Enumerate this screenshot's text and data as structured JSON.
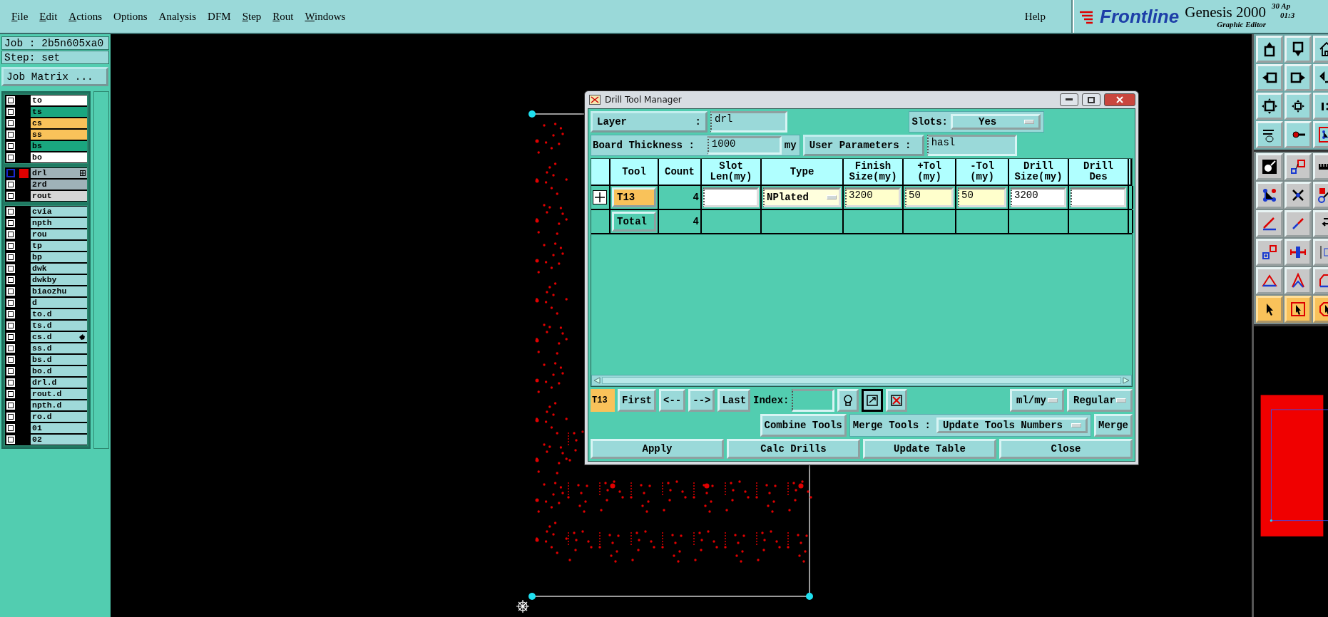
{
  "menu_bar": {
    "items": [
      {
        "label": "File",
        "mnemonic": true
      },
      {
        "label": "Edit",
        "mnemonic": true
      },
      {
        "label": "Actions",
        "mnemonic": true
      },
      {
        "label": "Options",
        "mnemonic": false
      },
      {
        "label": "Analysis",
        "mnemonic": false
      },
      {
        "label": "DFM",
        "mnemonic": false
      },
      {
        "label": "Step",
        "mnemonic": true
      },
      {
        "label": "Rout",
        "mnemonic": true
      },
      {
        "label": "Windows",
        "mnemonic": true
      }
    ],
    "help": "Help"
  },
  "brand": {
    "logo": "Frontline",
    "product": "Genesis 2000",
    "subtitle": "Graphic Editor",
    "date": "30 Ap",
    "time": "01:3"
  },
  "job_panel": {
    "job": "Job : 2b5n605xa0",
    "step": "Step: set",
    "matrix_button": "Job Matrix ...",
    "layer_groups": [
      {
        "layers": [
          {
            "name": "to",
            "color": "#ffffff",
            "affected": false,
            "work": false,
            "opened": false,
            "pointer": false
          },
          {
            "name": "ts",
            "color": "#1aa67f",
            "affected": false,
            "work": false,
            "opened": false,
            "pointer": false
          },
          {
            "name": "cs",
            "color": "#f9c25a",
            "affected": false,
            "work": false,
            "opened": false,
            "pointer": false
          },
          {
            "name": "ss",
            "color": "#f9c25a",
            "affected": false,
            "work": false,
            "opened": false,
            "pointer": false
          },
          {
            "name": "bs",
            "color": "#1aa67f",
            "affected": false,
            "work": false,
            "opened": false,
            "pointer": false
          },
          {
            "name": "bo",
            "color": "#ffffff",
            "affected": false,
            "work": false,
            "opened": false,
            "pointer": false
          }
        ]
      },
      {
        "layers": [
          {
            "name": "drl",
            "color": "#9fb2b8",
            "affected": true,
            "work": true,
            "opened": true,
            "pointer": false
          },
          {
            "name": "2rd",
            "color": "#9fb2b8",
            "affected": false,
            "work": false,
            "opened": false,
            "pointer": false
          },
          {
            "name": "rout",
            "color": "#d6d6d6",
            "affected": false,
            "work": false,
            "opened": false,
            "pointer": false
          }
        ]
      },
      {
        "layers": [
          {
            "name": "cvia",
            "color": "#9fd9d9",
            "affected": false,
            "work": false,
            "opened": false,
            "pointer": false
          },
          {
            "name": "npth",
            "color": "#9fd9d9",
            "affected": false,
            "work": false,
            "opened": false,
            "pointer": false
          },
          {
            "name": "rou",
            "color": "#9fd9d9",
            "affected": false,
            "work": false,
            "opened": false,
            "pointer": false
          },
          {
            "name": "tp",
            "color": "#9fd9d9",
            "affected": false,
            "work": false,
            "opened": false,
            "pointer": false
          },
          {
            "name": "bp",
            "color": "#9fd9d9",
            "affected": false,
            "work": false,
            "opened": false,
            "pointer": false
          },
          {
            "name": "dwk",
            "color": "#9fd9d9",
            "affected": false,
            "work": false,
            "opened": false,
            "pointer": false
          },
          {
            "name": "dwkby",
            "color": "#9fd9d9",
            "affected": false,
            "work": false,
            "opened": false,
            "pointer": false
          },
          {
            "name": "biaozhu",
            "color": "#9fd9d9",
            "affected": false,
            "work": false,
            "opened": false,
            "pointer": false
          },
          {
            "name": "d",
            "color": "#9fd9d9",
            "affected": false,
            "work": false,
            "opened": false,
            "pointer": false
          },
          {
            "name": "to.d",
            "color": "#9fd9d9",
            "affected": false,
            "work": false,
            "opened": false,
            "pointer": false
          },
          {
            "name": "ts.d",
            "color": "#9fd9d9",
            "affected": false,
            "work": false,
            "opened": false,
            "pointer": false
          },
          {
            "name": "cs.d",
            "color": "#9fd9d9",
            "affected": false,
            "work": false,
            "opened": false,
            "pointer": true
          },
          {
            "name": "ss.d",
            "color": "#9fd9d9",
            "affected": false,
            "work": false,
            "opened": false,
            "pointer": false
          },
          {
            "name": "bs.d",
            "color": "#9fd9d9",
            "affected": false,
            "work": false,
            "opened": false,
            "pointer": false
          },
          {
            "name": "bo.d",
            "color": "#9fd9d9",
            "affected": false,
            "work": false,
            "opened": false,
            "pointer": false
          },
          {
            "name": "drl.d",
            "color": "#9fd9d9",
            "affected": false,
            "work": false,
            "opened": false,
            "pointer": false
          },
          {
            "name": "rout.d",
            "color": "#9fd9d9",
            "affected": false,
            "work": false,
            "opened": false,
            "pointer": false
          },
          {
            "name": "npth.d",
            "color": "#9fd9d9",
            "affected": false,
            "work": false,
            "opened": false,
            "pointer": false
          },
          {
            "name": "ro.d",
            "color": "#9fd9d9",
            "affected": false,
            "work": false,
            "opened": false,
            "pointer": false
          },
          {
            "name": "01",
            "color": "#9fd9d9",
            "affected": false,
            "work": false,
            "opened": false,
            "pointer": false
          },
          {
            "name": "02",
            "color": "#9fd9d9",
            "affected": false,
            "work": false,
            "opened": false,
            "pointer": false
          }
        ]
      }
    ]
  },
  "dialog": {
    "title": "Drill Tool Manager",
    "layer": {
      "label": "Layer",
      "colon": ":",
      "value": "drl"
    },
    "slots": {
      "label": "Slots:",
      "value": "Yes"
    },
    "thickness": {
      "label": "Board Thickness :",
      "value": "1000",
      "unit": "my"
    },
    "user_parameters": {
      "label": "User Parameters :",
      "value": "hasl"
    },
    "table": {
      "columns": [
        "Tool",
        "Count",
        "Slot\nLen(my)",
        "Type",
        "Finish\nSize(my)",
        "+Tol\n(my)",
        "-Tol\n(my)",
        "Drill\nSize(my)",
        "Drill\nDes"
      ],
      "rows": [
        {
          "kind": "tool",
          "tool": "T13",
          "count": "4",
          "type": "NPlated",
          "finish_size": "3200",
          "plus_tol": "50",
          "minus_tol": "50",
          "drill_size": "3200"
        },
        {
          "kind": "total",
          "tool": "Total",
          "count": "4"
        }
      ]
    },
    "navigator": {
      "current": "T13",
      "buttons": [
        "First",
        "<--",
        "-->",
        "Last"
      ],
      "index_label": "Index:",
      "icon_buttons": [
        {
          "kind": "bulb",
          "pressed": false
        },
        {
          "kind": "box-arrow",
          "pressed": true
        },
        {
          "kind": "cross",
          "pressed": false
        }
      ],
      "units": "ml/my",
      "mode": "Regular"
    },
    "merge": {
      "combine": "Combine Tools",
      "label": "Merge Tools :",
      "option": "Update Tools Numbers",
      "button": "Merge"
    },
    "actions": [
      "Apply",
      "Calc Drills",
      "Update Table",
      "Close"
    ]
  },
  "tool_groups": [
    {
      "buttons": [
        {
          "kind": "box-up",
          "lit": false
        },
        {
          "kind": "box-down",
          "lit": false
        },
        {
          "kind": "house",
          "lit": false
        },
        {
          "kind": "box-left",
          "lit": false
        },
        {
          "kind": "box-right",
          "lit": false
        },
        {
          "kind": "undo",
          "lit": false
        },
        {
          "kind": "fit",
          "lit": false
        },
        {
          "kind": "small-fit",
          "lit": false
        },
        {
          "kind": "ratio",
          "lit": false
        },
        {
          "kind": "wrench",
          "lit": false
        },
        {
          "kind": "probe",
          "lit": false
        },
        {
          "kind": "net",
          "lit": false
        }
      ]
    },
    {
      "buttons": [
        {
          "kind": "circle-arrow",
          "lit": false
        },
        {
          "kind": "squares",
          "lit": false
        },
        {
          "kind": "ruler",
          "lit": false
        },
        {
          "kind": "dots",
          "lit": false
        },
        {
          "kind": "cross",
          "lit": false
        },
        {
          "kind": "ring-arrow",
          "lit": false
        },
        {
          "kind": "slant",
          "lit": false
        },
        {
          "kind": "diagonal",
          "lit": false
        },
        {
          "kind": "hook",
          "lit": false
        },
        {
          "kind": "square-arrow",
          "lit": false
        },
        {
          "kind": "bar",
          "lit": false
        },
        {
          "kind": "bracket",
          "lit": false
        },
        {
          "kind": "triangle",
          "lit": false
        },
        {
          "kind": "peak",
          "lit": false
        },
        {
          "kind": "arch",
          "lit": false
        },
        {
          "kind": "cursor",
          "lit": true
        },
        {
          "kind": "cursor-box",
          "lit": true
        },
        {
          "kind": "cursor-octagon",
          "lit": true
        }
      ]
    }
  ]
}
